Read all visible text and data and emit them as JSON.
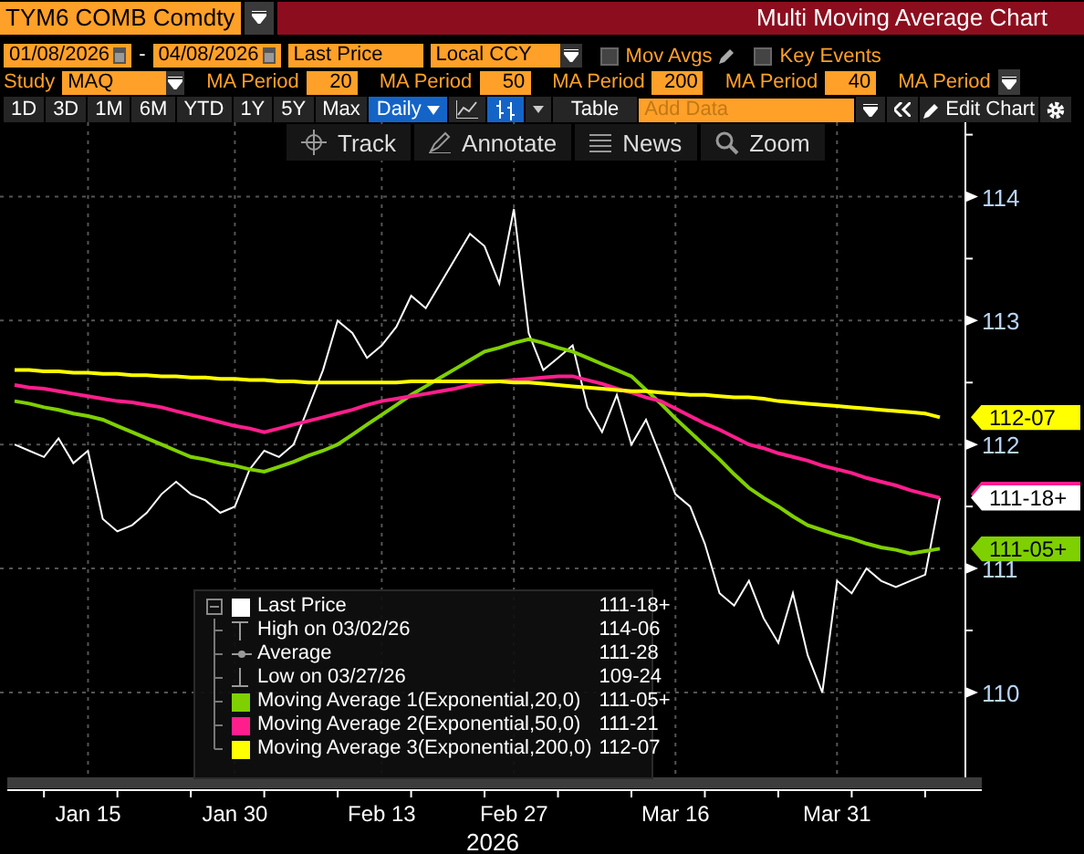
{
  "header": {
    "security": "TYM6 COMB Comdty",
    "title": "Multi Moving Average Chart"
  },
  "controls": {
    "start_date": "01/08/2026",
    "date_separator": "-",
    "end_date": "04/08/2026",
    "price_field": "Last Price",
    "currency": "Local CCY",
    "checkboxes": [
      {
        "label": "Mov Avgs",
        "checked": false,
        "kind": "editable"
      },
      {
        "label": "Key Events",
        "checked": false,
        "kind": "plain"
      }
    ]
  },
  "study": {
    "label": "Study",
    "value": "MAQ",
    "periods": [
      {
        "label": "MA Period",
        "value": "20"
      },
      {
        "label": "MA Period",
        "value": "50"
      },
      {
        "label": "MA Period",
        "value": "200"
      },
      {
        "label": "MA Period",
        "value": "40"
      },
      {
        "label": "MA Period"
      }
    ]
  },
  "toolbar": {
    "ranges": [
      {
        "label": "1D",
        "selected": false
      },
      {
        "label": "3D",
        "selected": false
      },
      {
        "label": "1M",
        "selected": false
      },
      {
        "label": "6M",
        "selected": false
      },
      {
        "label": "YTD",
        "selected": false
      },
      {
        "label": "1Y",
        "selected": false
      },
      {
        "label": "5Y",
        "selected": false
      },
      {
        "label": "Max",
        "selected": false
      }
    ],
    "interval": {
      "label": "Daily",
      "selected": true
    },
    "chart_styles": [
      {
        "kind": "line",
        "selected": false
      },
      {
        "kind": "bar",
        "selected": true
      }
    ],
    "table": "Table",
    "add_data": {
      "placeholder": "Add Data"
    },
    "edit_chart": "Edit Chart"
  },
  "chart_tools": [
    {
      "kind": "track",
      "label": "Track"
    },
    {
      "kind": "annotate",
      "label": "Annotate"
    },
    {
      "kind": "news",
      "label": "News"
    },
    {
      "kind": "zoom",
      "label": "Zoom"
    }
  ],
  "chart": {
    "chart_data": {
      "type": "line",
      "xlabel": "2026",
      "grid": true,
      "ylim": [
        109.3,
        114.6
      ],
      "categories": [
        null,
        null,
        null,
        null,
        null,
        "Jan 15",
        null,
        null,
        null,
        null,
        null,
        null,
        null,
        null,
        null,
        "Jan 30",
        null,
        null,
        null,
        null,
        null,
        null,
        null,
        null,
        null,
        "Feb 13",
        null,
        null,
        null,
        null,
        null,
        null,
        null,
        null,
        "Feb 27",
        null,
        null,
        null,
        null,
        null,
        null,
        null,
        null,
        null,
        null,
        "Mar 16",
        null,
        null,
        null,
        null,
        null,
        null,
        null,
        null,
        null,
        null,
        "Mar 31",
        null,
        null,
        null,
        null,
        null,
        null,
        null
      ],
      "yticks": [
        110,
        111,
        112,
        113,
        114
      ],
      "series": [
        {
          "color": "#ffffff",
          "values": [
            112.0,
            111.95,
            111.9,
            112.05,
            111.85,
            111.95,
            111.4,
            111.3,
            111.35,
            111.45,
            111.6,
            111.7,
            111.6,
            111.55,
            111.45,
            111.5,
            111.8,
            111.95,
            111.9,
            112.0,
            112.3,
            112.6,
            113.0,
            112.9,
            112.7,
            112.8,
            112.95,
            113.2,
            113.1,
            113.3,
            113.5,
            113.7,
            113.6,
            113.3,
            113.9,
            112.9,
            112.6,
            112.7,
            112.8,
            112.3,
            112.1,
            112.4,
            112.0,
            112.2,
            111.9,
            111.6,
            111.5,
            111.2,
            110.8,
            110.7,
            110.9,
            110.6,
            110.4,
            110.8,
            110.3,
            110.0,
            110.9,
            110.8,
            111.0,
            110.9,
            110.85,
            110.9,
            110.95,
            111.57
          ]
        },
        {
          "color": "#7fd000",
          "values": [
            112.35,
            112.33,
            112.3,
            112.28,
            112.25,
            112.23,
            112.2,
            112.15,
            112.1,
            112.05,
            112.0,
            111.95,
            111.9,
            111.88,
            111.85,
            111.83,
            111.8,
            111.78,
            111.82,
            111.86,
            111.91,
            111.95,
            112.0,
            112.08,
            112.16,
            112.24,
            112.32,
            112.4,
            112.47,
            112.54,
            112.61,
            112.68,
            112.75,
            112.78,
            112.82,
            112.85,
            112.82,
            112.78,
            112.75,
            112.7,
            112.65,
            112.6,
            112.55,
            112.44,
            112.33,
            112.21,
            112.1,
            111.99,
            111.88,
            111.76,
            111.65,
            111.57,
            111.5,
            111.42,
            111.35,
            111.31,
            111.27,
            111.24,
            111.2,
            111.17,
            111.15,
            111.12,
            111.14,
            111.16
          ]
        },
        {
          "color": "#ff1e8c",
          "values": [
            112.48,
            112.46,
            112.45,
            112.43,
            112.41,
            112.39,
            112.37,
            112.35,
            112.34,
            112.32,
            112.3,
            112.27,
            112.24,
            112.21,
            112.18,
            112.15,
            112.13,
            112.1,
            112.13,
            112.16,
            112.19,
            112.22,
            112.25,
            112.28,
            112.32,
            112.35,
            112.37,
            112.39,
            112.41,
            112.43,
            112.45,
            112.48,
            112.5,
            112.51,
            112.52,
            112.53,
            112.54,
            112.55,
            112.55,
            112.52,
            112.49,
            112.45,
            112.42,
            112.38,
            112.35,
            112.29,
            112.23,
            112.17,
            112.12,
            112.06,
            112.0,
            111.97,
            111.93,
            111.9,
            111.87,
            111.83,
            111.8,
            111.77,
            111.73,
            111.7,
            111.67,
            111.63,
            111.6,
            111.57
          ]
        },
        {
          "color": "#ffff00",
          "values": [
            112.6,
            112.6,
            112.59,
            112.59,
            112.58,
            112.58,
            112.57,
            112.57,
            112.56,
            112.56,
            112.55,
            112.55,
            112.54,
            112.54,
            112.53,
            112.53,
            112.52,
            112.52,
            112.51,
            112.51,
            112.5,
            112.5,
            112.5,
            112.5,
            112.5,
            112.5,
            112.5,
            112.51,
            112.51,
            112.51,
            112.51,
            112.51,
            112.51,
            112.51,
            112.5,
            112.5,
            112.49,
            112.48,
            112.47,
            112.46,
            112.45,
            112.44,
            112.43,
            112.43,
            112.42,
            112.41,
            112.4,
            112.4,
            112.39,
            112.38,
            112.38,
            112.37,
            112.35,
            112.34,
            112.33,
            112.32,
            112.31,
            112.3,
            112.29,
            112.28,
            112.27,
            112.26,
            112.25,
            112.22
          ]
        }
      ]
    }
  },
  "price_tags": [
    {
      "text": "112-07",
      "color": "#ffff00"
    },
    {
      "color": "#ff1e8c"
    },
    {
      "text": "111-18+",
      "color": "#ffffff"
    },
    {
      "text": "111-05+",
      "color": "#7fd000"
    }
  ],
  "legend": [
    {
      "kind": "swatch",
      "color": "#ffffff",
      "label": "Last Price",
      "value": "111-18+"
    },
    {
      "kind": "high",
      "label": "High on 03/02/26",
      "value": "114-06"
    },
    {
      "kind": "average",
      "label": "Average",
      "value": "111-28"
    },
    {
      "kind": "low",
      "label": "Low on 03/27/26",
      "value": "109-24"
    },
    {
      "kind": "swatch",
      "color": "#7fd000",
      "label": "Moving Average 1(Exponential,20,0)",
      "value": "111-05+"
    },
    {
      "kind": "swatch",
      "color": "#ff1e8c",
      "label": "Moving Average 2(Exponential,50,0)",
      "value": "111-21"
    },
    {
      "kind": "swatch",
      "color": "#ffff00",
      "label": "Moving Average 3(Exponential,200,0)",
      "value": "112-07"
    }
  ]
}
